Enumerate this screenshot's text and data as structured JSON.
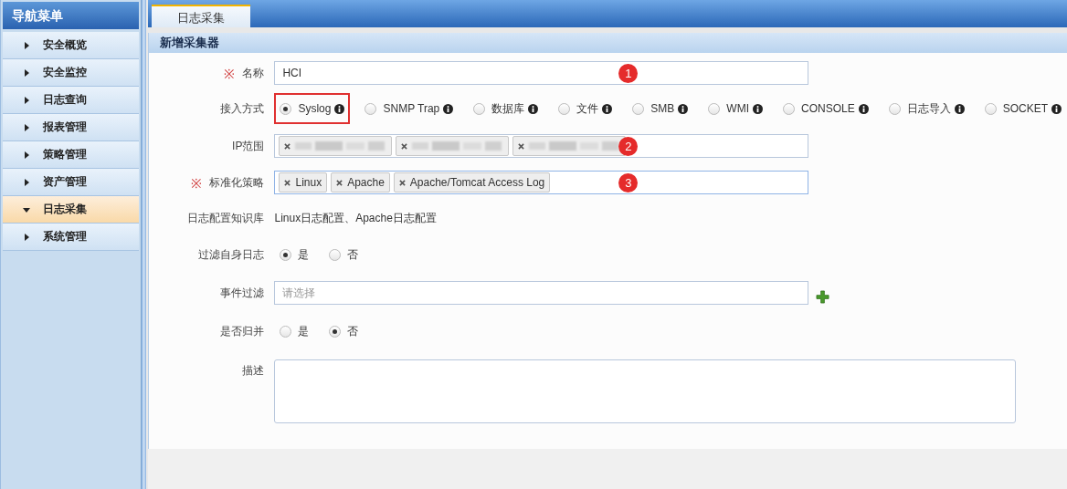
{
  "sidebar": {
    "title": "导航菜单",
    "items": [
      {
        "label": "安全概览",
        "expanded": false,
        "selected": false
      },
      {
        "label": "安全监控",
        "expanded": false,
        "selected": false
      },
      {
        "label": "日志查询",
        "expanded": false,
        "selected": false
      },
      {
        "label": "报表管理",
        "expanded": false,
        "selected": false
      },
      {
        "label": "策略管理",
        "expanded": false,
        "selected": false
      },
      {
        "label": "资产管理",
        "expanded": false,
        "selected": false
      },
      {
        "label": "日志采集",
        "expanded": true,
        "selected": true
      },
      {
        "label": "系统管理",
        "expanded": false,
        "selected": false
      }
    ]
  },
  "tabs": [
    {
      "label": "日志采集",
      "selected": true
    }
  ],
  "panel": {
    "title": "新增采集器"
  },
  "fields": [
    {
      "kind": "text",
      "mark": "※",
      "label": "名称",
      "value": "HCI",
      "badge": "1"
    },
    {
      "kind": "radio",
      "label": "接入方式",
      "options": [
        {
          "label": "Syslog",
          "selected": true,
          "highlighted": true
        },
        {
          "label": "SNMP Trap",
          "selected": false
        },
        {
          "label": "数据库",
          "selected": false
        },
        {
          "label": "文件",
          "selected": false
        },
        {
          "label": "SMB",
          "selected": false
        },
        {
          "label": "WMI",
          "selected": false
        },
        {
          "label": "CONSOLE",
          "selected": false
        },
        {
          "label": "日志导入",
          "selected": false
        },
        {
          "label": "SOCKET",
          "selected": false
        }
      ]
    },
    {
      "kind": "tags",
      "label": "IP范围",
      "badge": "2",
      "focused": false,
      "tags": [
        {
          "kind": "redacted"
        },
        {
          "kind": "redacted"
        },
        {
          "kind": "redacted"
        }
      ]
    },
    {
      "kind": "tags",
      "mark": "※",
      "label": "标准化策略",
      "badge": "3",
      "focused": true,
      "tags": [
        {
          "kind": "text",
          "label": "Linux"
        },
        {
          "kind": "text",
          "label": "Apache"
        },
        {
          "kind": "text",
          "label": "Apache/Tomcat Access Log"
        }
      ]
    },
    {
      "kind": "plain",
      "label": "日志配置知识库",
      "value": "Linux日志配置、Apache日志配置"
    },
    {
      "kind": "radio",
      "label": "过滤自身日志",
      "options": [
        {
          "label": "是",
          "selected": true
        },
        {
          "label": "否",
          "selected": false
        }
      ]
    },
    {
      "kind": "select",
      "label": "事件过滤",
      "placeholder": "请选择",
      "add_button": true
    },
    {
      "kind": "radio",
      "label": "是否归并",
      "options": [
        {
          "label": "是",
          "selected": false
        },
        {
          "label": "否",
          "selected": true
        }
      ]
    },
    {
      "kind": "textarea",
      "label": "描述"
    }
  ]
}
